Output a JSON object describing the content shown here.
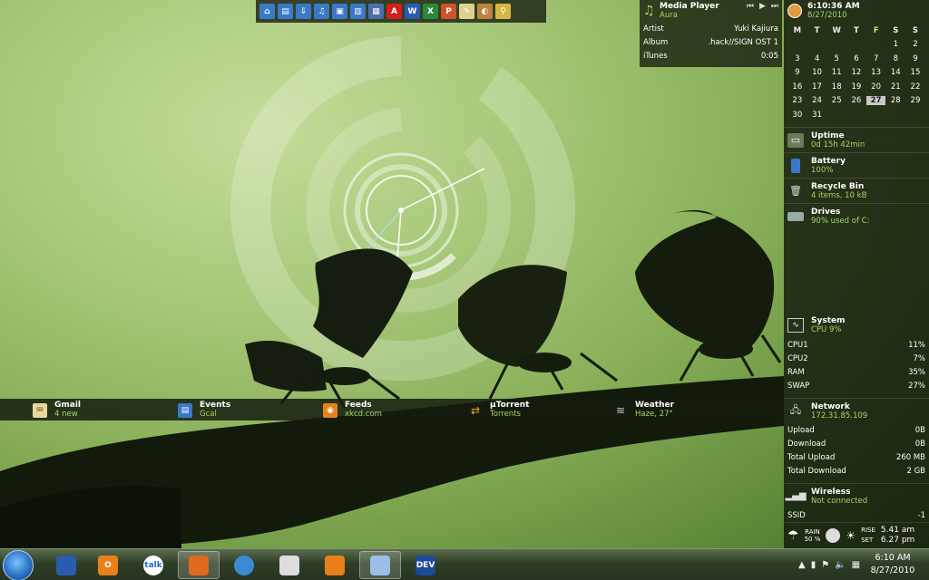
{
  "launcher": {
    "icons": [
      "home-icon",
      "folder-icon",
      "downloads-icon",
      "music-icon",
      "pictures-icon",
      "videos-icon",
      "computer-icon",
      "adobe-icon",
      "word-icon",
      "excel-icon",
      "powerpoint-icon",
      "notes-icon",
      "paint-icon",
      "broom-icon"
    ]
  },
  "media_player": {
    "title": "Media Player",
    "subtitle": "Aura",
    "rows": [
      {
        "label": "Artist",
        "value": "Yuki Kajiura"
      },
      {
        "label": "Album",
        "value": ".hack//SIGN OST 1"
      },
      {
        "label": "iTunes",
        "value": "0:05"
      }
    ]
  },
  "clock": {
    "time": "6:10:36 AM",
    "date": "8/27/2010"
  },
  "calendar": {
    "days": [
      "M",
      "T",
      "W",
      "T",
      "F",
      "S",
      "S"
    ],
    "weeks": [
      [
        "",
        "",
        "",
        "",
        "",
        "1",
        "2"
      ],
      [
        "3",
        "4",
        "5",
        "6",
        "7",
        "8",
        "9"
      ],
      [
        "9",
        "10",
        "11",
        "12",
        "13",
        "14",
        "15"
      ],
      [
        "16",
        "17",
        "18",
        "19",
        "20",
        "21",
        "22"
      ],
      [
        "23",
        "24",
        "25",
        "26",
        "27",
        "28",
        "29"
      ],
      [
        "30",
        "31",
        "",
        "",
        "",
        "",
        ""
      ]
    ],
    "today": "27"
  },
  "gadgets": [
    {
      "title": "Uptime",
      "sub": "0d 15h 42min",
      "icon": "monitor-icon"
    },
    {
      "title": "Battery",
      "sub": "100%",
      "icon": "battery-icon"
    },
    {
      "title": "Recycle Bin",
      "sub": "4 items, 10 kB",
      "icon": "recycle-bin-icon"
    },
    {
      "title": "Drives",
      "sub": "90% used of C:",
      "icon": "drive-icon"
    }
  ],
  "system": {
    "title": "System",
    "sub": "CPU 9%",
    "rows": [
      {
        "label": "CPU1",
        "value": "11%"
      },
      {
        "label": "CPU2",
        "value": "7%"
      },
      {
        "label": "RAM",
        "value": "35%"
      },
      {
        "label": "SWAP",
        "value": "27%"
      }
    ]
  },
  "network": {
    "title": "Network",
    "sub": "172.31.85.109",
    "rows": [
      {
        "label": "Upload",
        "value": "0B"
      },
      {
        "label": "Download",
        "value": "0B"
      },
      {
        "label": "Total Upload",
        "value": "260 MB"
      },
      {
        "label": "Total Download",
        "value": "2 GB"
      }
    ]
  },
  "wireless": {
    "title": "Wireless",
    "sub": "Not connected",
    "ssid_label": "SSID",
    "ssid_value": "-1"
  },
  "weather_strip": {
    "rain_label": "RAIN",
    "rain_value": "50 %",
    "rise_label": "RISE",
    "rise_value": "5.41 am",
    "set_label": "SET",
    "set_value": "6.27 pm"
  },
  "bottom_bar": [
    {
      "title": "Gmail",
      "sub": "4 new",
      "icon": "mail-icon"
    },
    {
      "title": "Events",
      "sub": "Gcal",
      "icon": "calendar-icon"
    },
    {
      "title": "Feeds",
      "sub": "xkcd.com",
      "icon": "rss-icon"
    },
    {
      "title": "µTorrent",
      "sub": "Torrents",
      "icon": "torrent-icon"
    },
    {
      "title": "Weather",
      "sub": "Haze, 27°",
      "icon": "weather-icon"
    }
  ],
  "taskbar": {
    "items": [
      {
        "icon": "remote-desktop-icon",
        "text": ""
      },
      {
        "icon": "outlook-icon",
        "text": "O"
      },
      {
        "icon": "google-talk-icon",
        "text": "talk"
      },
      {
        "icon": "firefox-icon",
        "text": ""
      },
      {
        "icon": "safari-icon",
        "text": ""
      },
      {
        "icon": "snipping-tool-icon",
        "text": ""
      },
      {
        "icon": "media-player-icon",
        "text": ""
      },
      {
        "icon": "itunes-icon",
        "text": ""
      },
      {
        "icon": "dev-icon",
        "text": "DEV"
      }
    ],
    "time": "6:10 AM",
    "date": "8/27/2010"
  }
}
